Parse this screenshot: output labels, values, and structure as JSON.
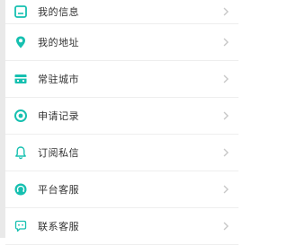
{
  "colors": {
    "accent": "#16c0b0",
    "text": "#333333",
    "chevron": "#c8c8c8",
    "divider": "#eeeeee"
  },
  "menu": {
    "items": [
      {
        "label": "我的信息",
        "icon": "id-card-icon"
      },
      {
        "label": "我的地址",
        "icon": "location-pin-icon"
      },
      {
        "label": "常驻城市",
        "icon": "city-buildings-icon"
      },
      {
        "label": "申请记录",
        "icon": "record-circle-icon"
      },
      {
        "label": "订阅私信",
        "icon": "bell-icon"
      },
      {
        "label": "平台客服",
        "icon": "headset-icon"
      },
      {
        "label": "联系客服",
        "icon": "chat-icon"
      }
    ]
  }
}
